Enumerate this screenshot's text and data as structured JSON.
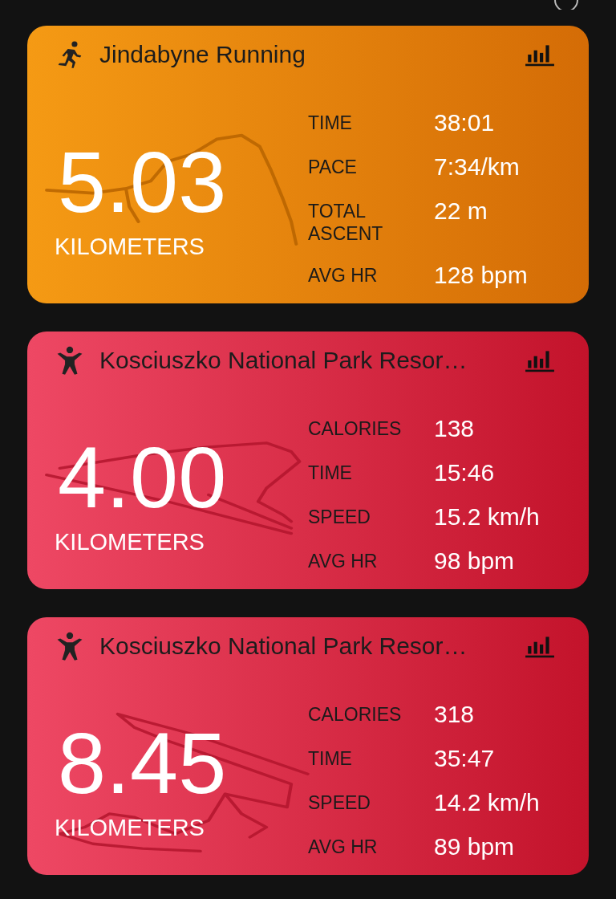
{
  "activities": [
    {
      "kind": "run",
      "title": "Jindabyne Running",
      "distance": "5.03",
      "unit": "KILOMETERS",
      "stats": [
        {
          "label": "TIME",
          "value": "38:01"
        },
        {
          "label": "PACE",
          "value": "7:34/km"
        },
        {
          "label": "TOTAL ASCENT",
          "value": "22 m"
        },
        {
          "label": "AVG HR",
          "value": "128 bpm"
        }
      ]
    },
    {
      "kind": "ski",
      "title": "Kosciuszko National Park Resor…",
      "distance": "4.00",
      "unit": "KILOMETERS",
      "stats": [
        {
          "label": "CALORIES",
          "value": "138"
        },
        {
          "label": "TIME",
          "value": "15:46"
        },
        {
          "label": "SPEED",
          "value": "15.2 km/h"
        },
        {
          "label": "AVG HR",
          "value": "98 bpm"
        }
      ]
    },
    {
      "kind": "ski",
      "title": "Kosciuszko National Park Resor…",
      "distance": "8.45",
      "unit": "KILOMETERS",
      "stats": [
        {
          "label": "CALORIES",
          "value": "318"
        },
        {
          "label": "TIME",
          "value": "35:47"
        },
        {
          "label": "SPEED",
          "value": "14.2 km/h"
        },
        {
          "label": "AVG HR",
          "value": "89 bpm"
        }
      ]
    }
  ]
}
